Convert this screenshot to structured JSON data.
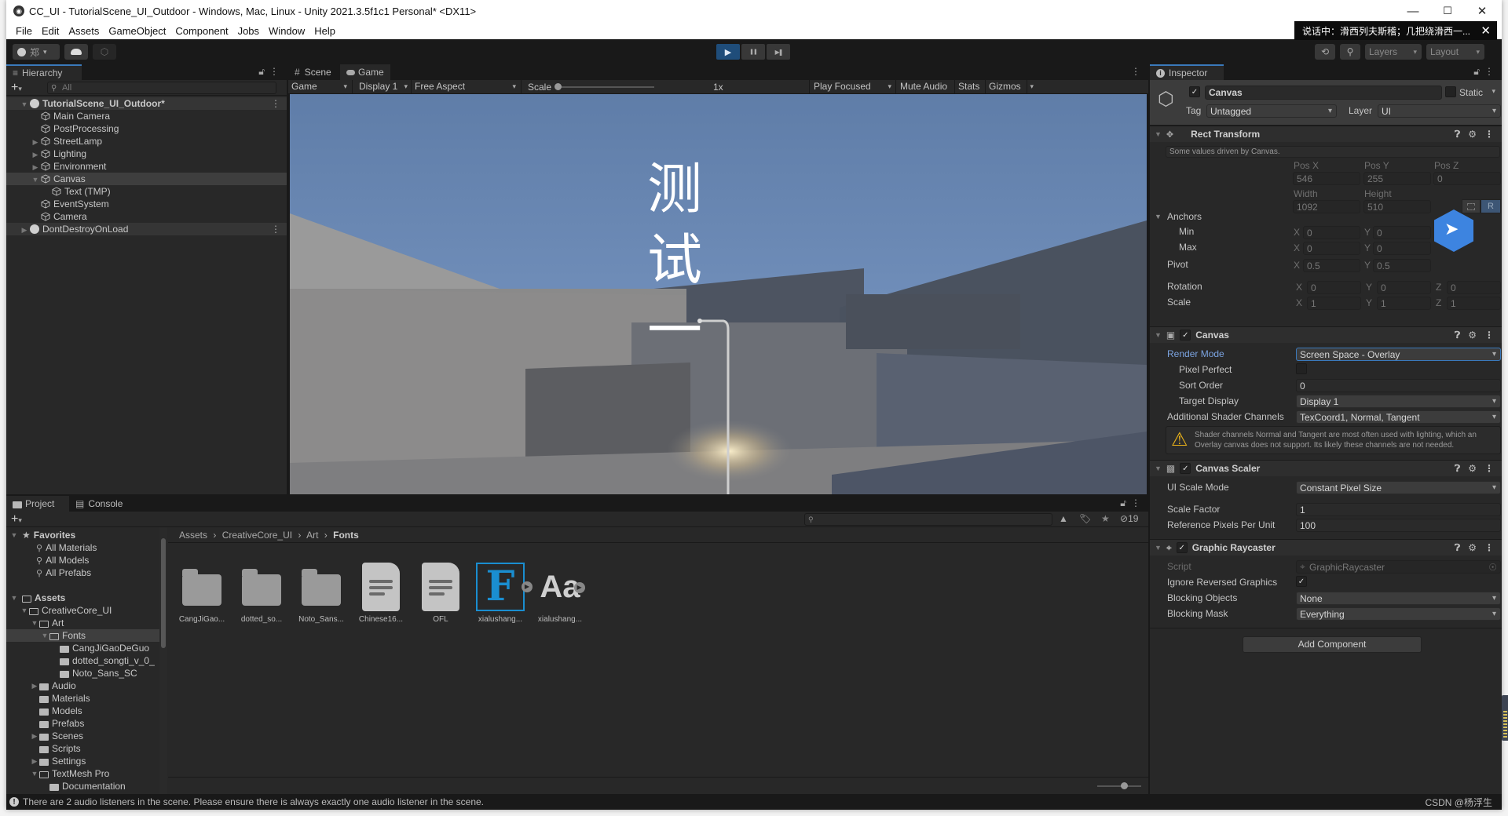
{
  "window": {
    "title": "CC_UI - TutorialScene_UI_Outdoor - Windows, Mac, Linux - Unity 2021.3.5f1c1 Personal* <DX11>",
    "minimize": "—",
    "maximize": "☐",
    "close": "✕"
  },
  "menu": [
    "File",
    "Edit",
    "Assets",
    "GameObject",
    "Component",
    "Jobs",
    "Window",
    "Help"
  ],
  "toolbar": {
    "account_label": "郑",
    "play_icon": "▶",
    "pause_icon": "❚❚",
    "step_icon": "▶❚",
    "layers_label": "Layers",
    "layout_label": "Layout"
  },
  "notification": {
    "text": "说话中：滑西列夫斯稽；几把绕滑西一...",
    "close": "✕"
  },
  "hierarchy": {
    "tab_label": "Hierarchy",
    "search_placeholder": "All",
    "items": [
      {
        "label": "TutorialScene_UI_Outdoor*",
        "depth": 0,
        "type": "scene",
        "expanded": true
      },
      {
        "label": "Main Camera",
        "depth": 1,
        "type": "object"
      },
      {
        "label": "PostProcessing",
        "depth": 1,
        "type": "object"
      },
      {
        "label": "StreetLamp",
        "depth": 1,
        "type": "object",
        "collapsed": true
      },
      {
        "label": "Lighting",
        "depth": 1,
        "type": "object",
        "collapsed": true
      },
      {
        "label": "Environment",
        "depth": 1,
        "type": "object",
        "collapsed": true
      },
      {
        "label": "Canvas",
        "depth": 1,
        "type": "object",
        "expanded": true,
        "selected": true
      },
      {
        "label": "Text (TMP)",
        "depth": 2,
        "type": "object"
      },
      {
        "label": "EventSystem",
        "depth": 1,
        "type": "object"
      },
      {
        "label": "Camera",
        "depth": 1,
        "type": "object"
      },
      {
        "label": "DontDestroyOnLoad",
        "depth": 0,
        "type": "scene",
        "collapsed": true
      }
    ]
  },
  "game_view": {
    "tabs": [
      {
        "label": "Scene",
        "icon": "#"
      },
      {
        "label": "Game",
        "icon": "gamepad"
      }
    ],
    "active_tab": "Game",
    "mode_dropdown": "Game",
    "display_dropdown": "Display 1",
    "aspect_dropdown": "Free Aspect",
    "scale_label": "Scale",
    "scale_value": "1x",
    "scale_fraction": 0.0,
    "play_focused": "Play Focused",
    "mute_audio": "Mute Audio",
    "stats": "Stats",
    "gizmos": "Gizmos",
    "overlay_text": [
      "测",
      "试",
      "一"
    ]
  },
  "inspector": {
    "tab_label": "Inspector",
    "object_name": "Canvas",
    "active": true,
    "static_label": "Static",
    "static": false,
    "tag_label": "Tag",
    "tag_value": "Untagged",
    "layer_label": "Layer",
    "layer_value": "UI",
    "rect_transform": {
      "title": "Rect Transform",
      "note": "Some values driven by Canvas.",
      "pos_x_label": "Pos X",
      "pos_y_label": "Pos Y",
      "pos_z_label": "Pos Z",
      "pos_x": "546",
      "pos_y": "255",
      "pos_z": "0",
      "width_label": "Width",
      "height_label": "Height",
      "width": "1092",
      "height": "510",
      "r_button": "R",
      "anchors_label": "Anchors",
      "min_label": "Min",
      "max_label": "Max",
      "min_x": "0",
      "min_y": "0",
      "max_x": "0",
      "max_y": "0",
      "pivot_label": "Pivot",
      "pivot_x": "0.5",
      "pivot_y": "0.5",
      "rotation_label": "Rotation",
      "rot_x": "0",
      "rot_y": "0",
      "rot_z": "0",
      "scale_label": "Scale",
      "scale_x": "1",
      "scale_y": "1",
      "scale_z": "1"
    },
    "canvas": {
      "title": "Canvas",
      "render_mode_label": "Render Mode",
      "render_mode": "Screen Space - Overlay",
      "pixel_perfect_label": "Pixel Perfect",
      "pixel_perfect": false,
      "sort_order_label": "Sort Order",
      "sort_order": "0",
      "target_display_label": "Target Display",
      "target_display": "Display 1",
      "shader_channels_label": "Additional Shader Channels",
      "shader_channels": "TexCoord1, Normal, Tangent",
      "warning": "Shader channels Normal and Tangent are most often used with lighting, which an Overlay canvas does not support. Its likely these channels are not needed."
    },
    "canvas_scaler": {
      "title": "Canvas Scaler",
      "ui_scale_mode_label": "UI Scale Mode",
      "ui_scale_mode": "Constant Pixel Size",
      "scale_factor_label": "Scale Factor",
      "scale_factor": "1",
      "ref_ppu_label": "Reference Pixels Per Unit",
      "ref_ppu": "100"
    },
    "graphic_raycaster": {
      "title": "Graphic Raycaster",
      "script_label": "Script",
      "script": "GraphicRaycaster",
      "ignore_reversed_label": "Ignore Reversed Graphics",
      "ignore_reversed": true,
      "blocking_objects_label": "Blocking Objects",
      "blocking_objects": "None",
      "blocking_mask_label": "Blocking Mask",
      "blocking_mask": "Everything"
    },
    "add_component": "Add Component"
  },
  "project": {
    "tabs": [
      {
        "label": "Project"
      },
      {
        "label": "Console"
      }
    ],
    "favorites_label": "Favorites",
    "favorites": [
      "All Materials",
      "All Models",
      "All Prefabs"
    ],
    "assets_label": "Assets",
    "tree": [
      {
        "label": "CreativeCore_UI",
        "depth": 1,
        "expanded": true
      },
      {
        "label": "Art",
        "depth": 2,
        "expanded": true
      },
      {
        "label": "Fonts",
        "depth": 3,
        "expanded": true,
        "selected": true
      },
      {
        "label": "CangJiGaoDeGuo",
        "depth": 4
      },
      {
        "label": "dotted_songti_v_0_",
        "depth": 4
      },
      {
        "label": "Noto_Sans_SC",
        "depth": 4
      },
      {
        "label": "Audio",
        "depth": 2,
        "collapsed": true
      },
      {
        "label": "Materials",
        "depth": 2
      },
      {
        "label": "Models",
        "depth": 2
      },
      {
        "label": "Prefabs",
        "depth": 2
      },
      {
        "label": "Scenes",
        "depth": 2,
        "collapsed": true
      },
      {
        "label": "Scripts",
        "depth": 2
      },
      {
        "label": "Settings",
        "depth": 2,
        "collapsed": true
      },
      {
        "label": "TextMesh Pro",
        "depth": 2,
        "expanded": true
      },
      {
        "label": "Documentation",
        "depth": 3
      }
    ],
    "breadcrumb": [
      "Assets",
      "CreativeCore_UI",
      "Art",
      "Fonts"
    ],
    "search_placeholder": "",
    "hidden_count": "19",
    "assets": [
      {
        "label": "CangJiGao...",
        "type": "folder"
      },
      {
        "label": "dotted_so...",
        "type": "folder"
      },
      {
        "label": "Noto_Sans...",
        "type": "folder"
      },
      {
        "label": "Chinese16...",
        "type": "text"
      },
      {
        "label": "OFL",
        "type": "text"
      },
      {
        "label": "xialushang...",
        "type": "font"
      },
      {
        "label": "xialushang...",
        "type": "font-asset"
      }
    ],
    "font_glyph": "F",
    "font_asset_glyph": "Aa"
  },
  "status_bar": {
    "message": "There are 2 audio listeners in the scene. Please ensure there is always exactly one audio listener in the scene.",
    "watermark": "CSDN @杨浮生"
  }
}
